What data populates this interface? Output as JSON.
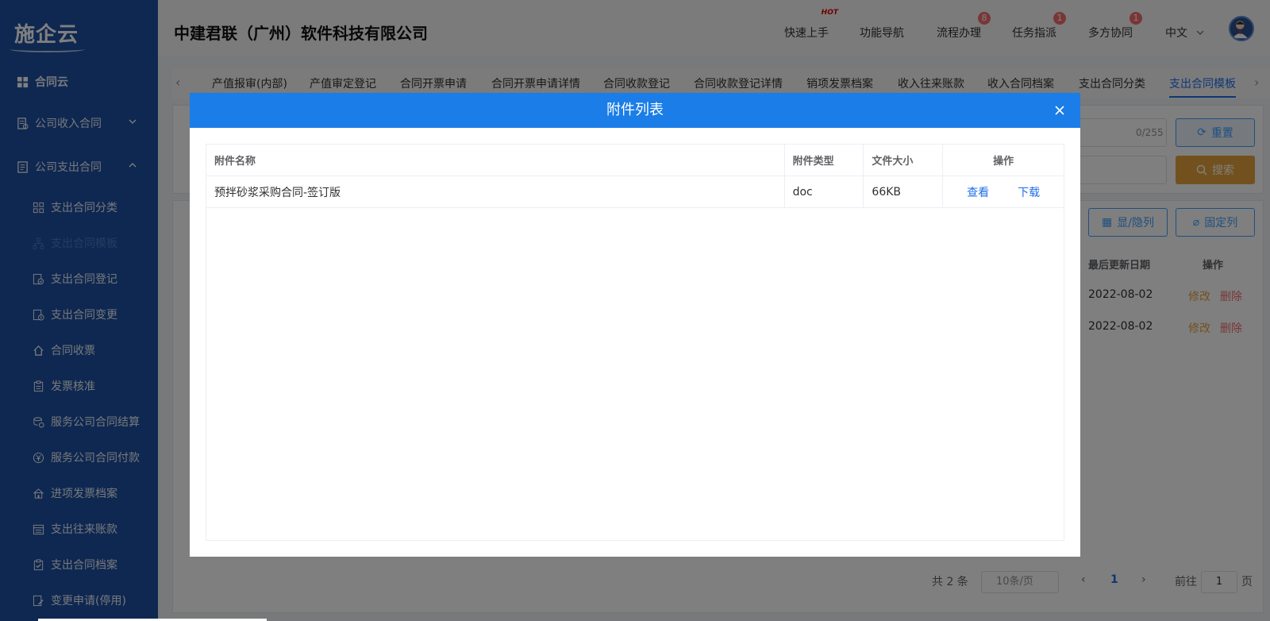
{
  "sidebar": {
    "logo": "施企云",
    "items": [
      {
        "label": "合同云",
        "icon": "grid-icon"
      },
      {
        "label": "公司收入合同",
        "icon": "contract-icon"
      },
      {
        "label": "公司支出合同",
        "icon": "document-icon"
      },
      {
        "label": "支出合同分类",
        "icon": "apps-icon"
      },
      {
        "label": "支出合同模板",
        "icon": "tree-icon"
      },
      {
        "label": "支出合同登记",
        "icon": "register-icon"
      },
      {
        "label": "支出合同变更",
        "icon": "change-icon"
      },
      {
        "label": "合同收票",
        "icon": "receive-icon"
      },
      {
        "label": "发票核准",
        "icon": "clipboard-icon"
      },
      {
        "label": "服务公司合同结算",
        "icon": "coins-icon"
      },
      {
        "label": "服务公司合同付款",
        "icon": "yen-icon"
      },
      {
        "label": "进项发票档案",
        "icon": "archive-icon"
      },
      {
        "label": "支出往来账款",
        "icon": "ledger-icon"
      },
      {
        "label": "支出合同档案",
        "icon": "check-file-icon"
      },
      {
        "label": "变更申请(停用)",
        "icon": "edit-file-icon"
      }
    ]
  },
  "header": {
    "company": "中建君联（广州）软件科技有限公司",
    "nav": [
      {
        "label": "快速上手",
        "badge": "HOT"
      },
      {
        "label": "功能导航",
        "badge": ""
      },
      {
        "label": "流程办理",
        "badge": "8"
      },
      {
        "label": "任务指派",
        "badge": "1"
      },
      {
        "label": "多方协同",
        "badge": "1"
      }
    ],
    "language": "中文"
  },
  "tabs": [
    "产值报审(内部)",
    "产值审定登记",
    "合同开票申请",
    "合同开票申请详情",
    "合同收款登记",
    "合同收款登记详情",
    "销项发票档案",
    "收入往来账款",
    "收入合同档案",
    "支出合同分类",
    "支出合同模板"
  ],
  "background": {
    "counter": "0/255",
    "reset": "重置",
    "search": "搜索",
    "toggle_columns": "显/隐列",
    "fix_columns": "固定列",
    "col_updated": "最后更新日期",
    "col_ops": "操作",
    "rows": [
      {
        "date": "2022-08-02",
        "edit": "修改",
        "delete": "删除"
      },
      {
        "date": "2022-08-02",
        "edit": "修改",
        "delete": "删除"
      }
    ],
    "pagination": {
      "total": "共 2 条",
      "page_size": "10条/页",
      "current": "1",
      "goto": "前往",
      "goto_value": "1",
      "page_unit": "页"
    }
  },
  "dialog": {
    "title": "附件列表",
    "columns": {
      "name": "附件名称",
      "type": "附件类型",
      "size": "文件大小",
      "ops": "操作"
    },
    "rows": [
      {
        "name": "预拌砂浆采购合同-签订版",
        "type": "doc",
        "size": "66KB",
        "view": "查看",
        "download": "下载"
      }
    ]
  },
  "colors": {
    "sidebar": "#1e50a2",
    "dialog_header": "#1a7de8",
    "link": "#1e6fe8",
    "warning": "#e6a23c",
    "danger": "#f56c6c"
  }
}
